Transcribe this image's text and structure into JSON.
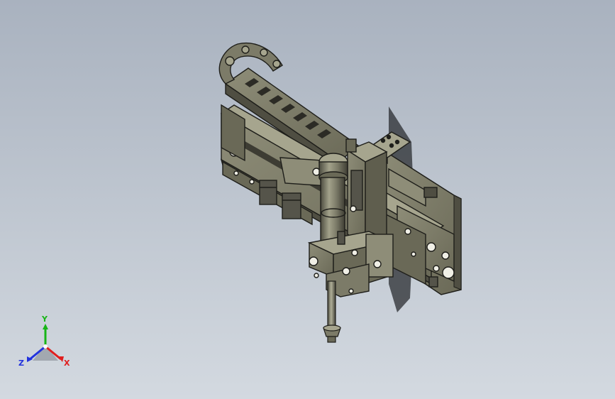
{
  "viewport": {
    "background_top": "#a9b2bf",
    "background_bottom": "#d3d9e0"
  },
  "model": {
    "body_color": "#7c7b68",
    "light_color": "#a6a58e",
    "dark_color": "#4f4e42",
    "edge_color": "#1e1e1a"
  },
  "triad": {
    "x_label": "X",
    "y_label": "Y",
    "z_label": "Z",
    "x_color": "#e01e1e",
    "y_color": "#17b517",
    "z_color": "#2233dd"
  }
}
